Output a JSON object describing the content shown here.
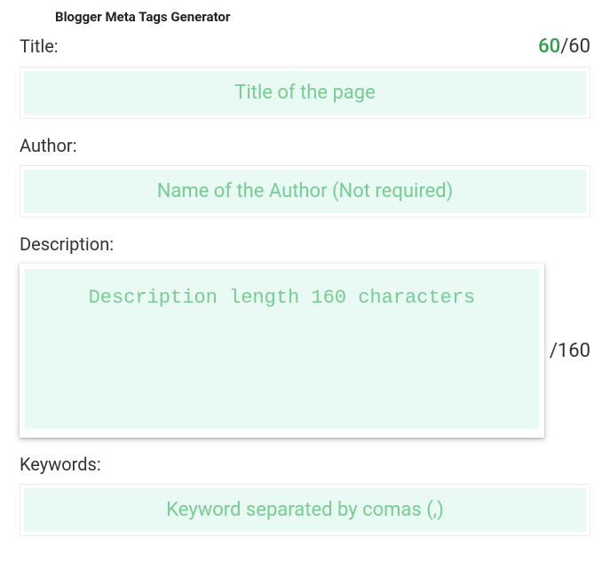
{
  "header": {
    "title": "Blogger Meta Tags Generator"
  },
  "fields": {
    "title": {
      "label": "Title:",
      "placeholder": "Title of the page",
      "value": "",
      "current": "60",
      "max": "/60"
    },
    "author": {
      "label": "Author:",
      "placeholder": "Name of the Author (Not required)",
      "value": ""
    },
    "description": {
      "label": "Description:",
      "placeholder": "Description length 160 characters",
      "value": "",
      "max": "/160"
    },
    "keywords": {
      "label": "Keywords:",
      "placeholder": "Keyword separated by comas (,)",
      "value": ""
    }
  }
}
